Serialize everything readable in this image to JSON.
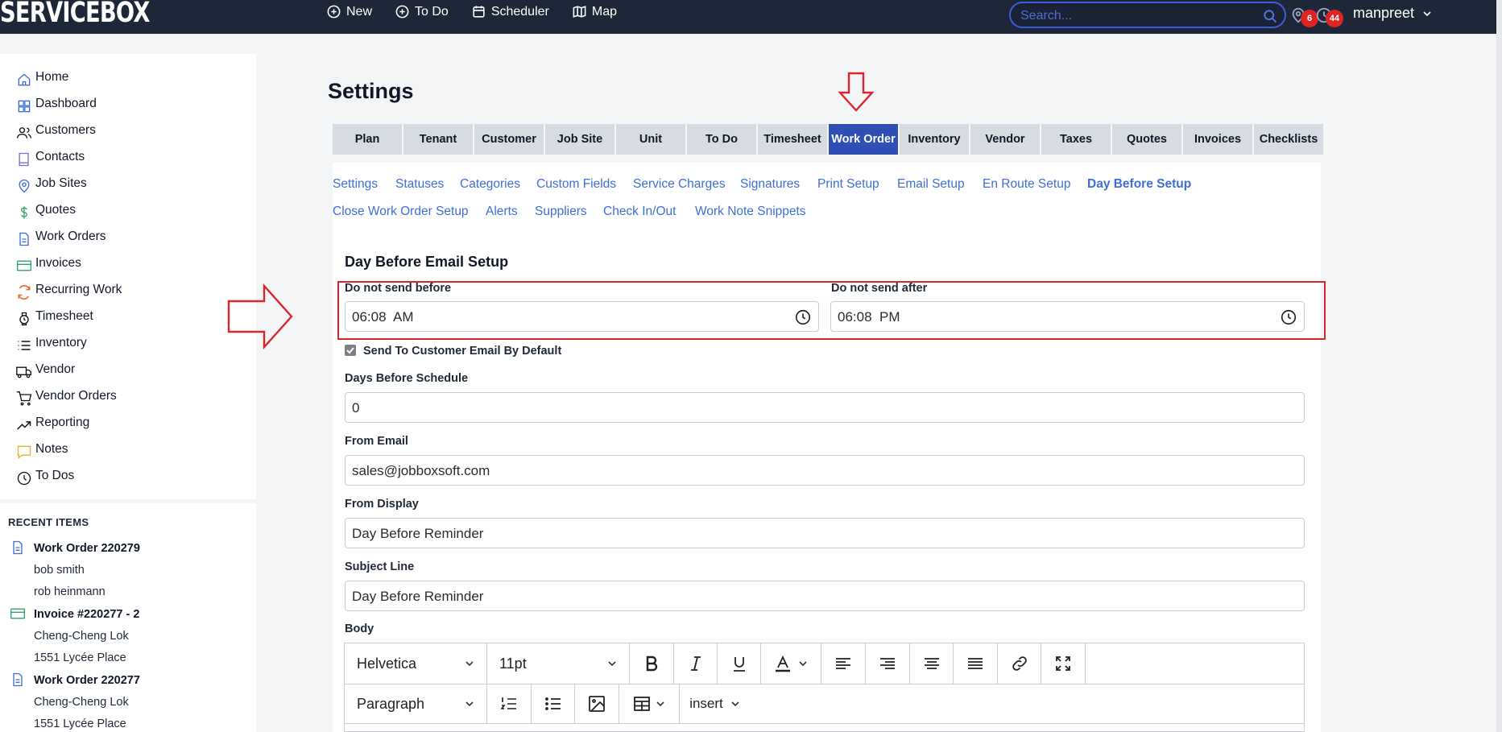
{
  "app": {
    "logo": "SERVICEBOX"
  },
  "topnav": [
    {
      "label": "New",
      "icon": "plus-circle-icon"
    },
    {
      "label": "To Do",
      "icon": "plus-circle-icon"
    },
    {
      "label": "Scheduler",
      "icon": "calendar-icon"
    },
    {
      "label": "Map",
      "icon": "map-icon"
    }
  ],
  "search": {
    "placeholder": "Search..."
  },
  "notifications": {
    "location_count": "6",
    "clock_count": "44"
  },
  "user": {
    "name": "manpreet"
  },
  "sidebar": {
    "items": [
      {
        "label": "Home",
        "icon": "home-icon"
      },
      {
        "label": "Dashboard",
        "icon": "dashboard-icon"
      },
      {
        "label": "Customers",
        "icon": "users-icon"
      },
      {
        "label": "Contacts",
        "icon": "contacts-icon"
      },
      {
        "label": "Job Sites",
        "icon": "map-pin-icon"
      },
      {
        "label": "Quotes",
        "icon": "dollar-icon"
      },
      {
        "label": "Work Orders",
        "icon": "document-icon"
      },
      {
        "label": "Invoices",
        "icon": "credit-card-icon"
      },
      {
        "label": "Recurring Work",
        "icon": "refresh-icon"
      },
      {
        "label": "Timesheet",
        "icon": "watch-icon"
      },
      {
        "label": "Inventory",
        "icon": "list-icon"
      },
      {
        "label": "Vendor",
        "icon": "truck-icon"
      },
      {
        "label": "Vendor Orders",
        "icon": "cart-icon"
      },
      {
        "label": "Reporting",
        "icon": "trending-up-icon"
      },
      {
        "label": "Notes",
        "icon": "note-icon"
      },
      {
        "label": "To Dos",
        "icon": "clock-icon"
      }
    ]
  },
  "recent": {
    "title": "RECENT ITEMS",
    "items": [
      {
        "type": "work-order",
        "title": "Work Order 220279",
        "lines": [
          "bob smith",
          "rob heinmann"
        ]
      },
      {
        "type": "invoice",
        "title": "Invoice #220277 - 2",
        "lines": [
          "Cheng-Cheng Lok",
          "1551 Lycée Place"
        ]
      },
      {
        "type": "work-order",
        "title": "Work Order 220277",
        "lines": [
          "Cheng-Cheng Lok",
          "1551 Lycée Place"
        ]
      }
    ]
  },
  "main": {
    "title": "Settings",
    "tabs": [
      "Plan",
      "Tenant",
      "Customer",
      "Job Site",
      "Unit",
      "To Do",
      "Timesheet",
      "Work Order",
      "Inventory",
      "Vendor",
      "Taxes",
      "Quotes",
      "Invoices",
      "Checklists"
    ],
    "active_tab": "Work Order",
    "sublinks": [
      "Settings",
      "Statuses",
      "Categories",
      "Custom Fields",
      "Service Charges",
      "Signatures",
      "Print Setup",
      "Email Setup",
      "En Route Setup",
      "Day Before Setup",
      "Close Work Order Setup",
      "Alerts",
      "Suppliers",
      "Check In/Out",
      "Work Note Snippets"
    ],
    "active_sublink": "Day Before Setup",
    "form": {
      "section_title": "Day Before Email Setup",
      "not_before_label": "Do not send before",
      "not_before_value": "06:08  AM",
      "not_after_label": "Do not send after",
      "not_after_value": "06:08  PM",
      "send_default_label": "Send To Customer Email By Default",
      "send_default_checked": true,
      "days_label": "Days Before Schedule",
      "days_value": "0",
      "from_email_label": "From Email",
      "from_email_value": "sales@jobboxsoft.com",
      "from_display_label": "From Display",
      "from_display_value": "Day Before Reminder",
      "subject_label": "Subject Line",
      "subject_value": "Day Before Reminder",
      "body_label": "Body"
    },
    "editor": {
      "font_family": "Helvetica",
      "font_size": "11pt",
      "block_format": "Paragraph",
      "insert_label": "insert"
    }
  },
  "colors": {
    "topbar": "#1d2738",
    "accent": "#2d4fb6",
    "link": "#3d6fd6",
    "highlight_red": "#d9262c",
    "badge": "#e02424"
  }
}
